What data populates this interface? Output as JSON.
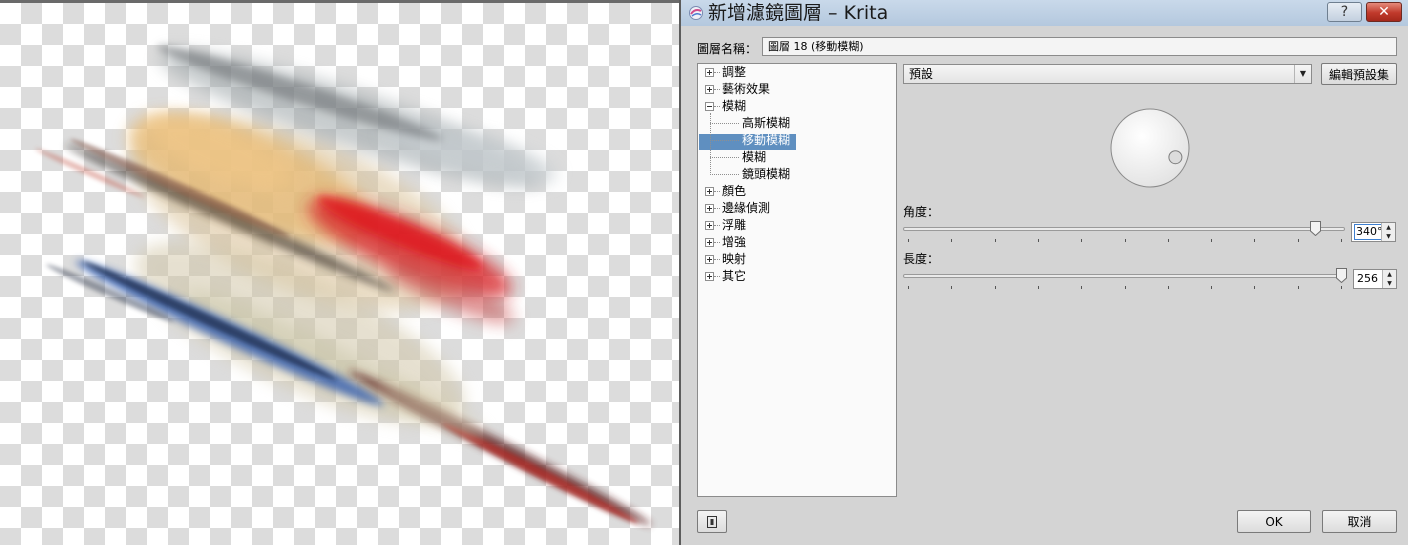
{
  "window": {
    "title": "新增濾鏡圖層 – Krita",
    "help_label": "?",
    "close_label": "✕"
  },
  "layer_name": {
    "label": "圖層名稱：",
    "value": "圖層 18 (移動模糊)"
  },
  "filter_tree": {
    "items": [
      {
        "label": "調整",
        "state": "collapsed"
      },
      {
        "label": "藝術效果",
        "state": "collapsed"
      },
      {
        "label": "模糊",
        "state": "expanded"
      },
      {
        "label": "高斯模糊"
      },
      {
        "label": "移動模糊",
        "selected": true
      },
      {
        "label": "模糊"
      },
      {
        "label": "鏡頭模糊"
      },
      {
        "label": "顏色",
        "state": "collapsed"
      },
      {
        "label": "邊緣偵測",
        "state": "collapsed"
      },
      {
        "label": "浮雕",
        "state": "collapsed"
      },
      {
        "label": "增強",
        "state": "collapsed"
      },
      {
        "label": "映射",
        "state": "collapsed"
      },
      {
        "label": "其它",
        "state": "collapsed"
      }
    ]
  },
  "preset": {
    "selected": "預設",
    "edit_label": "編輯預設集"
  },
  "angle": {
    "label": "角度：",
    "value": "340°",
    "level": 340,
    "max": 360
  },
  "length": {
    "label": "長度：",
    "value": "256",
    "level": 256,
    "max": 256
  },
  "buttons": {
    "ok": "OK",
    "cancel": "取消"
  },
  "icons": {
    "app": "krita-icon",
    "dropdown": "chevron-down-icon",
    "preview": "preview-toggle-icon"
  },
  "colors": {
    "title_bar": "#bfd2e6",
    "selection": "#5f8fc0",
    "close_button": "#c0392b"
  }
}
